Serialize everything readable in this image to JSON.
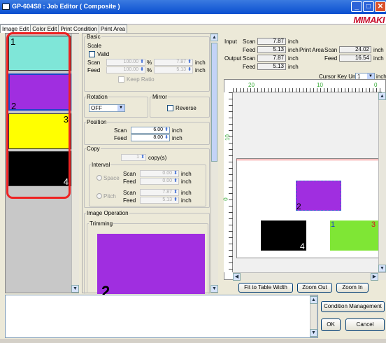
{
  "window": {
    "title": "GP-604S8 : Job Editor ( Composite )",
    "logo": "MIMAKI"
  },
  "tabs": [
    "Image Edit",
    "Color Edit",
    "Print Condition",
    "Print Area"
  ],
  "thumbnails": [
    {
      "num": "1",
      "color": "#7fe6d8",
      "numcolor": "#000"
    },
    {
      "num": "2",
      "color": "#a02ee0",
      "numcolor": "#000"
    },
    {
      "num": "3",
      "color": "#ffff00",
      "numcolor": "#000"
    },
    {
      "num": "4",
      "color": "#000000",
      "numcolor": "#fff"
    }
  ],
  "basic": {
    "group": "Basic",
    "scale": "Scale",
    "valid": "Valid",
    "scan": "Scan",
    "feed": "Feed",
    "scan_pct": "100.00",
    "feed_pct": "100.00",
    "pct": "%",
    "scan_inch": "7.87",
    "feed_inch": "5.13",
    "inch": "inch",
    "keep_ratio": "Keep Ratio"
  },
  "rotation": {
    "label": "Rotation",
    "value": "OFF"
  },
  "mirror": {
    "label": "Mirror",
    "reverse": "Reverse"
  },
  "position": {
    "label": "Position",
    "scan": "Scan",
    "feed": "Feed",
    "scan_val": "6.00",
    "feed_val": "8.00",
    "inch": "inch"
  },
  "copy": {
    "label": "Copy",
    "count": "1",
    "unit": "copy(s)",
    "interval": "Interval",
    "space": "Space",
    "pitch": "Pitch",
    "scan": "Scan",
    "feed": "Feed",
    "sp_scan": "0.00",
    "sp_feed": "0.00",
    "pt_scan": "7.87",
    "pt_feed": "5.13",
    "inch": "inch"
  },
  "image_operation": {
    "label": "Image Operation",
    "trimming": "Trimming",
    "preview_num": "2"
  },
  "info": {
    "input": "Input",
    "output": "Output",
    "scan": "Scan",
    "feed": "Feed",
    "inch": "inch",
    "input_scan": "7.87",
    "input_feed": "5.13",
    "output_scan": "7.87",
    "output_feed": "5.13",
    "print_area": "Print Area",
    "pa_scan": "24.02",
    "pa_feed": "16.54",
    "cursor_key_unit": "Cursor Key Unit",
    "cursor_val": "1"
  },
  "ruler": {
    "h": [
      "20",
      "10",
      "0"
    ],
    "v": [
      "10",
      "0"
    ]
  },
  "canvas": {
    "purple_num": "2",
    "black_num": "4",
    "green_left": "1",
    "green_right": "3"
  },
  "buttons": {
    "fit": "Fit to Table Width",
    "zoom_out": "Zoom Out",
    "zoom_in": "Zoom In",
    "condition": "Condition Management",
    "ok": "OK",
    "cancel": "Cancel"
  }
}
